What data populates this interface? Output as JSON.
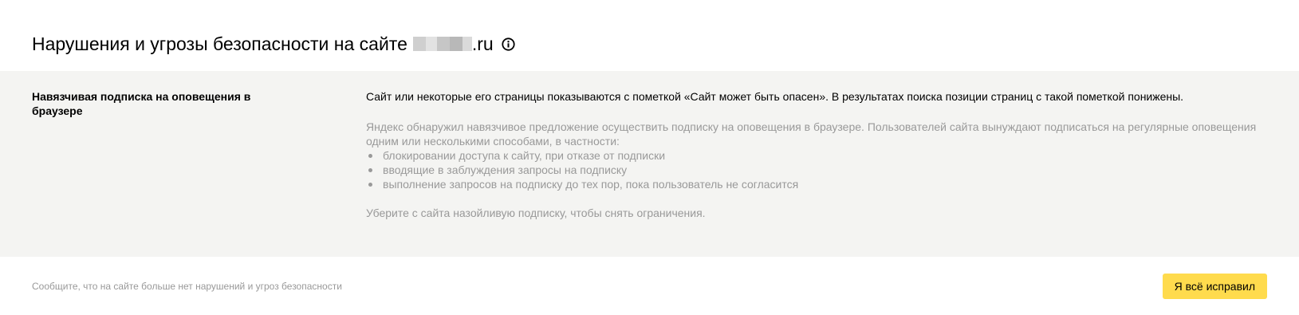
{
  "header": {
    "title_prefix": "Нарушения и угрозы безопасности на сайте",
    "domain_suffix": ".ru",
    "info_icon": "info-circle-icon"
  },
  "issue": {
    "title": "Навязчивая подписка на оповещения в браузере",
    "summary": "Сайт или некоторые его страницы показываются с пометкой «Сайт может быть опасен». В результатах поиска позиции страниц с такой пометкой понижены.",
    "description": "Яндекс обнаружил навязчивое предложение осуществить подписку на оповещения в браузере. Пользователей сайта вынуждают подписаться на регулярные оповещения одним или несколькими способами, в частности:",
    "ways": [
      "блокировании доступа к сайту, при отказе от подписки",
      "вводящие в заблуждения запросы на подписку",
      "выполнение запросов на подписку до тех пор, пока пользователь не согласится"
    ],
    "advice": "Уберите с сайта назойливую подписку, чтобы снять ограничения."
  },
  "footer": {
    "note": "Сообщите, что на сайте больше нет нарушений и угроз безопасности",
    "fix_button_label": "Я всё исправил"
  },
  "colors": {
    "accent_button": "#ffdb4d",
    "panel_background": "#f4f4f2",
    "muted_text": "#999999"
  }
}
